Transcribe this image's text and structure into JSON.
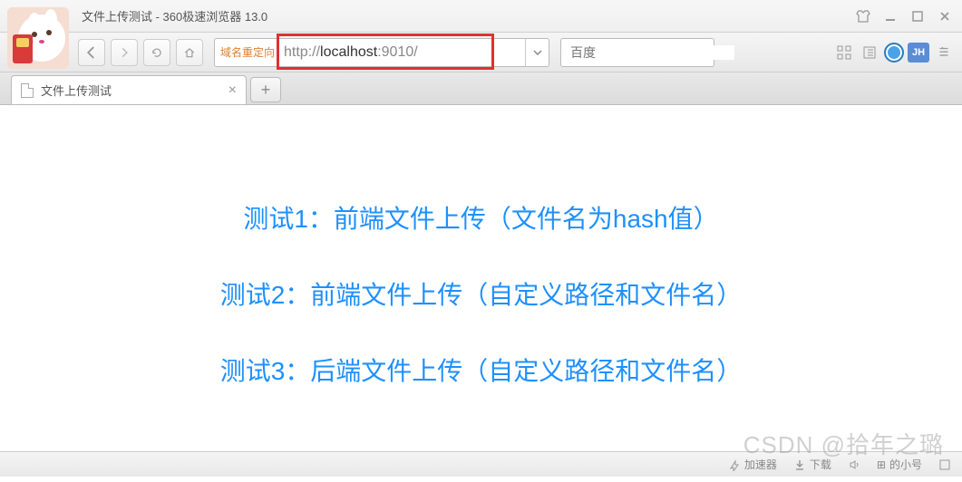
{
  "window": {
    "title": "文件上传测试 - 360极速浏览器 13.0"
  },
  "address": {
    "redirect_label": "域名重定向",
    "url_prefix": "http://",
    "url_host": "localhost",
    "url_suffix": ":9010/"
  },
  "search": {
    "placeholder": "百度"
  },
  "tab": {
    "label": "文件上传测试"
  },
  "links": [
    "测试1：前端文件上传（文件名为hash值）",
    "测试2：前端文件上传（自定义路径和文件名）",
    "测试3：后端文件上传（自定义路径和文件名）"
  ],
  "status": {
    "accelerator": "加速器",
    "download": "下载",
    "tools_suffix": "的小号",
    "jh_label": "JH"
  },
  "watermark": "CSDN @拾年之璐"
}
